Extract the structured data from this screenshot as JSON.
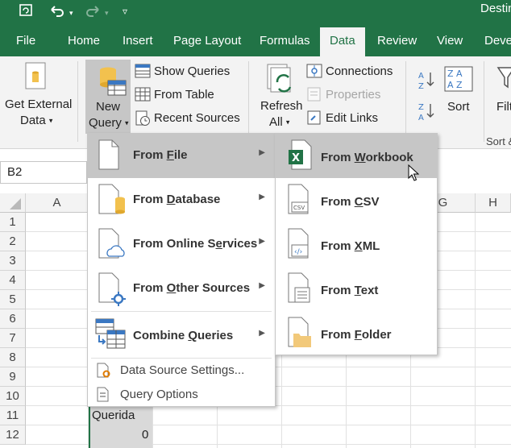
{
  "titlebar": {
    "title": "Destin"
  },
  "tabs": [
    "File",
    "Home",
    "Insert",
    "Page Layout",
    "Formulas",
    "Data",
    "Review",
    "View",
    "Deve"
  ],
  "active_tab": "Data",
  "ribbon": {
    "get_external_data": [
      "Get External",
      "Data"
    ],
    "new_query": [
      "New",
      "Query"
    ],
    "show_queries": "Show Queries",
    "from_table": "From Table",
    "recent_sources": "Recent Sources",
    "refresh_all": [
      "Refresh",
      "All"
    ],
    "connections": "Connections",
    "properties": "Properties",
    "edit_links": "Edit Links",
    "sort": "Sort",
    "filter_partial": "Filt",
    "sort_group_partial": "Sort &"
  },
  "namebox": "B2",
  "columns": [
    "A",
    "G",
    "H"
  ],
  "rows": [
    "1",
    "2",
    "3",
    "4",
    "5",
    "6",
    "7",
    "8",
    "9",
    "10",
    "11",
    "12"
  ],
  "cells": {
    "B11": "Querida",
    "B12": "0"
  },
  "menu": {
    "items": [
      {
        "label": "From File",
        "icon": "file-icon",
        "hovered": true
      },
      {
        "label": "From Database",
        "icon": "database-icon",
        "hovered": false
      },
      {
        "label": "From Online Services",
        "icon": "cloud-icon",
        "hovered": false
      },
      {
        "label": "From Other Sources",
        "icon": "other-sources-icon",
        "hovered": false
      },
      {
        "label": "Combine Queries",
        "icon": "combine-icon",
        "hovered": false
      }
    ],
    "small_items": [
      {
        "label": "Data Source Settings...",
        "icon": "settings-icon"
      },
      {
        "label": "Query Options",
        "icon": "options-icon"
      }
    ]
  },
  "submenu": {
    "items": [
      {
        "label": "From Workbook",
        "icon": "excel-icon",
        "hovered": true
      },
      {
        "label": "From CSV",
        "icon": "csv-icon",
        "hovered": false
      },
      {
        "label": "From XML",
        "icon": "xml-icon",
        "hovered": false
      },
      {
        "label": "From Text",
        "icon": "text-file-icon",
        "hovered": false
      },
      {
        "label": "From Folder",
        "icon": "folder-icon",
        "hovered": false
      }
    ]
  },
  "colors": {
    "excel_green": "#217346",
    "ribbon_bg": "#f3f3f3",
    "hover_gray": "#c6c6c6"
  }
}
